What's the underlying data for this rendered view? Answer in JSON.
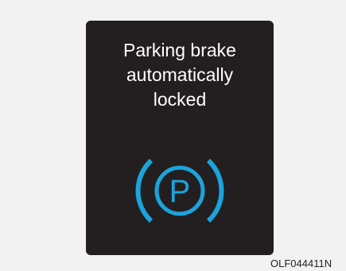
{
  "display": {
    "message_lines": [
      "Parking brake",
      "automatically",
      "locked"
    ],
    "icon": "parking-brake-icon",
    "icon_letter": "P",
    "icon_color": "#1ba4dc",
    "panel_color": "#231f20",
    "text_color": "#ffffff"
  },
  "image_code": "OLF044411N"
}
